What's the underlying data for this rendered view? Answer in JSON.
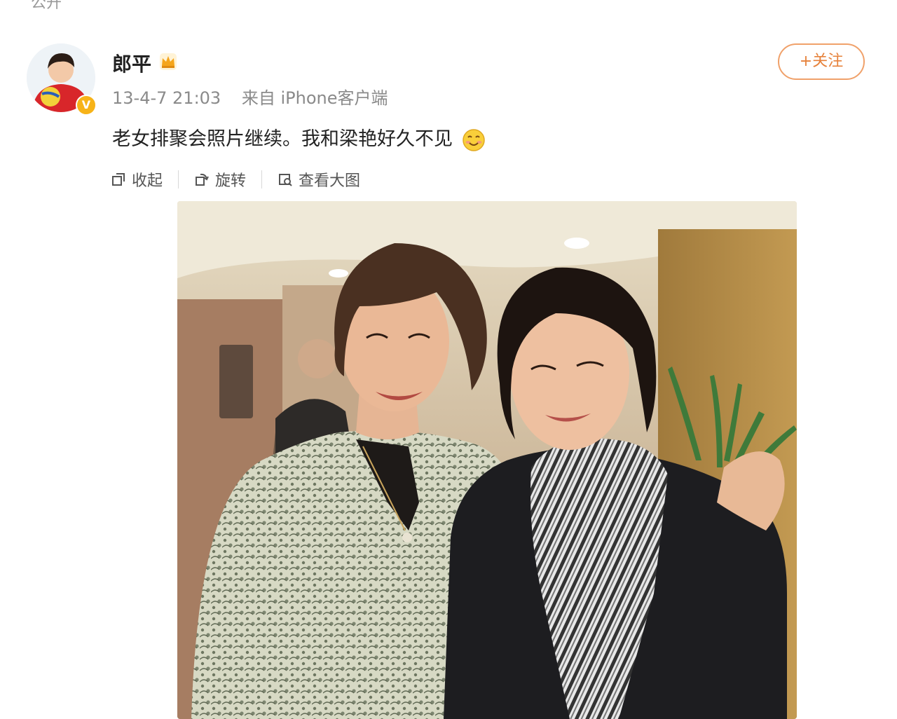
{
  "top_fragment": "公开",
  "user": {
    "name": "郎平",
    "verified_badge": "V"
  },
  "post": {
    "timestamp": "13-4-7 21:03",
    "source": "来自 iPhone客户端",
    "text": "老女排聚会照片继续。我和梁艳好久不见"
  },
  "buttons": {
    "follow": "+关注"
  },
  "actions": [
    {
      "label": "收起",
      "icon": "collapse-icon"
    },
    {
      "label": "旋转",
      "icon": "rotate-icon"
    },
    {
      "label": "查看大图",
      "icon": "view-large-icon"
    }
  ]
}
